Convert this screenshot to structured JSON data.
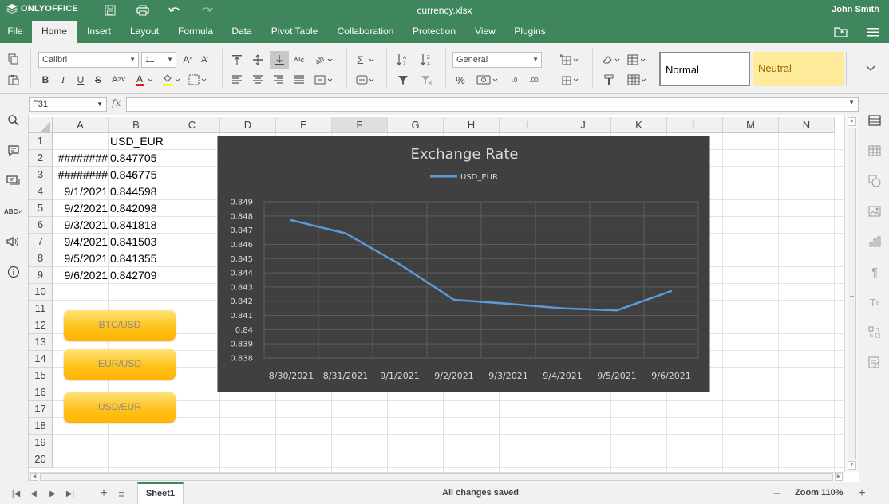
{
  "app": {
    "name": "ONLYOFFICE",
    "document_title": "currency.xlsx",
    "user": "John Smith"
  },
  "menu": {
    "tabs": [
      "File",
      "Home",
      "Insert",
      "Layout",
      "Formula",
      "Data",
      "Pivot Table",
      "Collaboration",
      "Protection",
      "View",
      "Plugins"
    ],
    "active": "Home"
  },
  "toolbar": {
    "font_name": "Calibri",
    "font_size": "11",
    "number_format": "General",
    "styles": {
      "normal": "Normal",
      "neutral": "Neutral"
    }
  },
  "formula_bar": {
    "name_box": "F31",
    "fx": "fx",
    "formula": ""
  },
  "sheet": {
    "columns": [
      "A",
      "B",
      "C",
      "D",
      "E",
      "F",
      "G",
      "H",
      "I",
      "J",
      "K",
      "L",
      "M",
      "N"
    ],
    "selected_column": "F",
    "rows": [
      "1",
      "2",
      "3",
      "4",
      "5",
      "6",
      "7",
      "8",
      "9",
      "10",
      "11",
      "12",
      "13",
      "14",
      "15",
      "16",
      "17",
      "18",
      "19",
      "20"
    ],
    "cells": {
      "B1": "USD_EUR",
      "A2": "########",
      "B2": "0.847705",
      "A3": "########",
      "B3": "0.846775",
      "A4": "9/1/2021",
      "B4": "0.844598",
      "A5": "9/2/2021",
      "B5": "0.842098",
      "A6": "9/3/2021",
      "B6": "0.841818",
      "A7": "9/4/2021",
      "B7": "0.841503",
      "A8": "9/5/2021",
      "B8": "0.841355",
      "A9": "9/6/2021",
      "B9": "0.842709"
    },
    "buttons": [
      "BTC/USD",
      "EUR/USD",
      "USD/EUR"
    ]
  },
  "chart_data": {
    "type": "line",
    "title": "Exchange Rate",
    "categories": [
      "8/30/2021",
      "8/31/2021",
      "9/1/2021",
      "9/2/2021",
      "9/3/2021",
      "9/4/2021",
      "9/5/2021",
      "9/6/2021"
    ],
    "series": [
      {
        "name": "USD_EUR",
        "values": [
          0.847705,
          0.846775,
          0.844598,
          0.842098,
          0.841818,
          0.841503,
          0.841355,
          0.842709
        ]
      }
    ],
    "yticks": [
      "0.849",
      "0.848",
      "0.847",
      "0.846",
      "0.845",
      "0.844",
      "0.843",
      "0.842",
      "0.841",
      "0.84",
      "0.839",
      "0.838"
    ],
    "ylim": [
      0.838,
      0.849
    ],
    "legend": "top",
    "grid": true,
    "colors": {
      "background": "#404040",
      "line": "#5b9bd5",
      "text": "#d9d9d9",
      "grid": "#5e5e5e"
    }
  },
  "statusbar": {
    "sheet_tab": "Sheet1",
    "status": "All changes saved",
    "zoom": "Zoom 110%"
  }
}
